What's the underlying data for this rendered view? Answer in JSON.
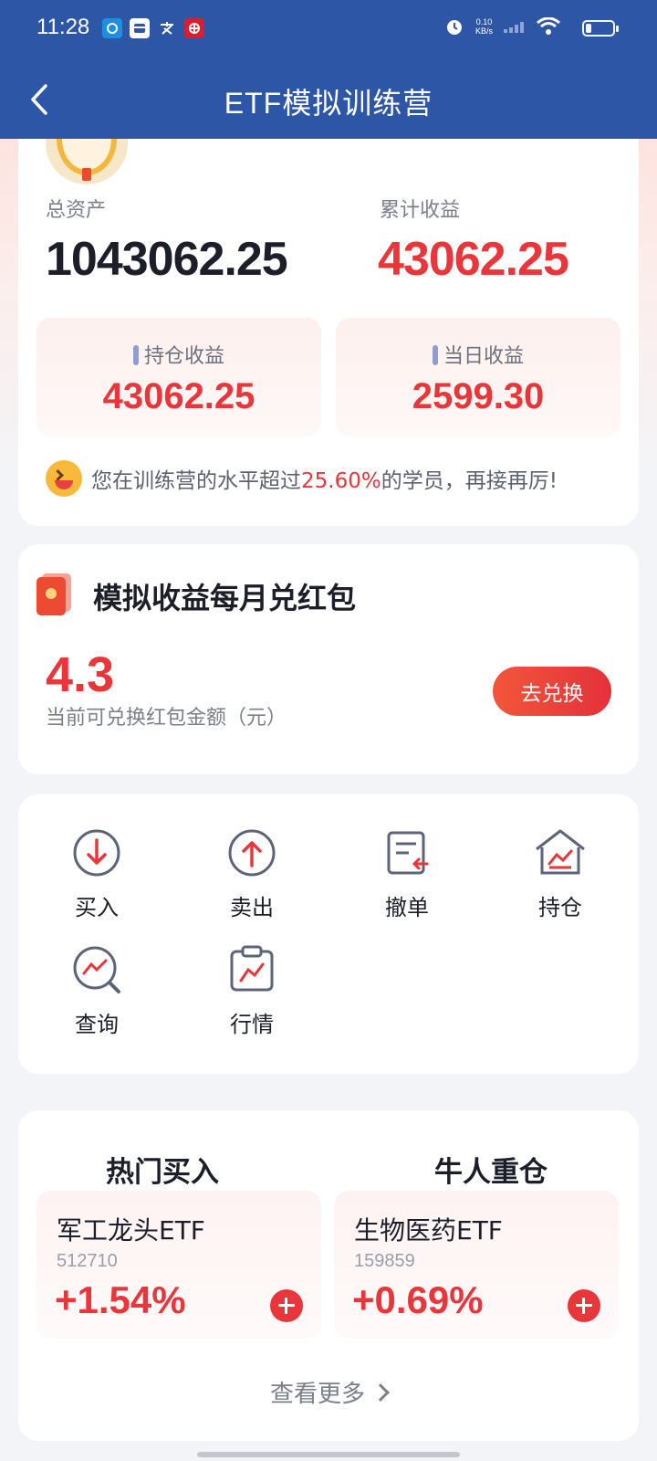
{
  "status_bar": {
    "time": "11:28",
    "net_speed_value": "0.10",
    "net_speed_unit": "KB/s",
    "left_icons": [
      "ccb-app-icon",
      "bank-card-icon",
      "alipay-icon",
      "bank-app-icon"
    ],
    "right_icons": [
      "alarm-icon",
      "signal-icon",
      "wifi-icon",
      "battery-icon"
    ]
  },
  "header": {
    "title": "ETF模拟训练营",
    "back_icon": "chevron-left-icon"
  },
  "assets": {
    "total_label": "总资产",
    "total_value": "1043062.25",
    "cumulative_label": "累计收益",
    "cumulative_value": "43062.25",
    "holding_label": "持仓收益",
    "holding_value": "43062.25",
    "daily_label": "当日收益",
    "daily_value": "2599.30",
    "level_prefix": "您在训练营的水平超过",
    "level_pct": "25.60%",
    "level_suffix": "的学员，再接再厉!"
  },
  "packet": {
    "title": "模拟收益每月兑红包",
    "value": "4.3",
    "desc": "当前可兑换红包金额（元）",
    "button": "去兑换"
  },
  "functions": [
    {
      "label": "买入",
      "icon": "buy-down-arrow-icon"
    },
    {
      "label": "卖出",
      "icon": "sell-up-arrow-icon"
    },
    {
      "label": "撤单",
      "icon": "cancel-order-icon"
    },
    {
      "label": "持仓",
      "icon": "holdings-house-icon"
    },
    {
      "label": "查询",
      "icon": "query-magnifier-icon"
    },
    {
      "label": "行情",
      "icon": "market-clipboard-icon"
    }
  ],
  "hot": {
    "tabs": [
      "热门买入",
      "牛人重仓"
    ],
    "active_tab": 0,
    "funds": [
      {
        "name": "军工龙头ETF",
        "code": "512710",
        "change": "+1.54%"
      },
      {
        "name": "生物医药ETF",
        "code": "159859",
        "change": "+0.69%"
      }
    ],
    "more": "查看更多"
  },
  "colors": {
    "header": "#2e56a6",
    "accent_red": "#e8363b"
  }
}
